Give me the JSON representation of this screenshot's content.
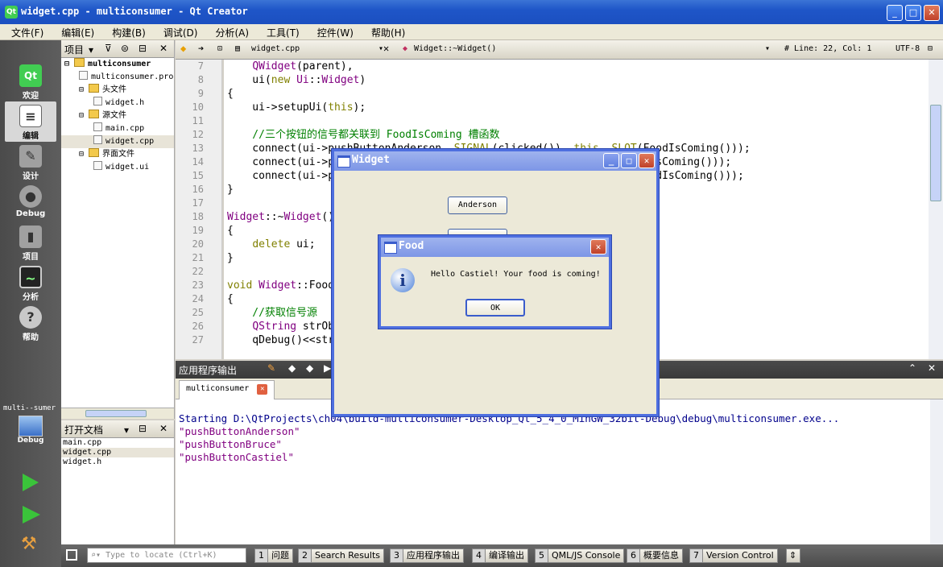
{
  "window": {
    "title": "widget.cpp - multiconsumer - Qt Creator",
    "icon_text": "Qt"
  },
  "menu": [
    "文件(F)",
    "编辑(E)",
    "构建(B)",
    "调试(D)",
    "分析(A)",
    "工具(T)",
    "控件(W)",
    "帮助(H)"
  ],
  "modes": [
    {
      "label": "欢迎",
      "icon": "qt-logo-icon"
    },
    {
      "label": "编辑",
      "icon": "edit-document-icon"
    },
    {
      "label": "设计",
      "icon": "design-pen-icon"
    },
    {
      "label": "Debug",
      "icon": "debug-bug-icon"
    },
    {
      "label": "项目",
      "icon": "project-icon"
    },
    {
      "label": "分析",
      "icon": "analyze-monitor-icon"
    },
    {
      "label": "帮助",
      "icon": "help-icon"
    }
  ],
  "kit": {
    "project": "multi--sumer",
    "mode": "Debug"
  },
  "project_panel": {
    "title": "项目",
    "tree": [
      {
        "label": "multiconsumer",
        "level": 0,
        "type": "root"
      },
      {
        "label": "multiconsumer.pro",
        "level": 1,
        "type": "file"
      },
      {
        "label": "头文件",
        "level": 1,
        "type": "folder"
      },
      {
        "label": "widget.h",
        "level": 2,
        "type": "file"
      },
      {
        "label": "源文件",
        "level": 1,
        "type": "folder"
      },
      {
        "label": "main.cpp",
        "level": 2,
        "type": "file"
      },
      {
        "label": "widget.cpp",
        "level": 2,
        "type": "file",
        "selected": true
      },
      {
        "label": "界面文件",
        "level": 1,
        "type": "folder"
      },
      {
        "label": "widget.ui",
        "level": 2,
        "type": "file"
      }
    ]
  },
  "open_docs": {
    "title": "打开文档",
    "items": [
      "main.cpp",
      "widget.cpp",
      "widget.h"
    ]
  },
  "editor_toolbar": {
    "file": "widget.cpp",
    "symbol": "Widget::~Widget()",
    "position": "#  Line: 22, Col: 1",
    "encoding": "UTF-8"
  },
  "code_lines": [
    {
      "n": "7",
      "text": "    QWidget(parent),"
    },
    {
      "n": "8",
      "text": "    ui(new Ui::Widget)"
    },
    {
      "n": "9",
      "text": "{"
    },
    {
      "n": "10",
      "text": "    ui->setupUi(this);"
    },
    {
      "n": "11",
      "text": ""
    },
    {
      "n": "12",
      "text": "    //三个按钮的信号都关联到 FoodIsComing 槽函数"
    },
    {
      "n": "13",
      "text": "    connect(ui->pushButtonAnderson, SIGNAL(clicked()), this, SLOT(FoodIsComing()));"
    },
    {
      "n": "14",
      "text": "    connect(ui->pushButtonBruce, SIGNAL(clicked()), this, SLOT(FoodIsComing()));"
    },
    {
      "n": "15",
      "text": "    connect(ui->pushButtonCastiel, SIGNAL(clicked()), this, SLOT(FoodIsComing()));"
    },
    {
      "n": "16",
      "text": "}"
    },
    {
      "n": "17",
      "text": ""
    },
    {
      "n": "18",
      "text": "Widget::~Widget()"
    },
    {
      "n": "19",
      "text": "{"
    },
    {
      "n": "20",
      "text": "    delete ui;"
    },
    {
      "n": "21",
      "text": "}"
    },
    {
      "n": "22",
      "text": ""
    },
    {
      "n": "23",
      "text": "void Widget::FoodIsComing()"
    },
    {
      "n": "24",
      "text": "{"
    },
    {
      "n": "25",
      "text": "    //获取信号源"
    },
    {
      "n": "26",
      "text": "    QString strObjectSrc = this->sender()->objectName();"
    },
    {
      "n": "27",
      "text": "    qDebug()<<strObjectSrc;"
    }
  ],
  "output_pane": {
    "title": "应用程序输出",
    "tab": "multiconsumer",
    "start_line": "Starting D:\\QtProjects\\ch04\\build-multiconsumer-Desktop_Qt_5_4_0_MinGW_32bit-Debug\\debug\\multiconsumer.exe...",
    "lines": [
      "\"pushButtonAnderson\"",
      "\"pushButtonBruce\"",
      "\"pushButtonCastiel\""
    ]
  },
  "status": {
    "locate_placeholder": "Type to locate (Ctrl+K)",
    "tabs": [
      {
        "n": "1",
        "label": "问题"
      },
      {
        "n": "2",
        "label": "Search Results"
      },
      {
        "n": "3",
        "label": "应用程序输出"
      },
      {
        "n": "4",
        "label": "编译输出"
      },
      {
        "n": "5",
        "label": "QML/JS Console"
      },
      {
        "n": "6",
        "label": "概要信息"
      },
      {
        "n": "7",
        "label": "Version Control"
      }
    ]
  },
  "widget_dialog": {
    "title": "Widget",
    "button1": "Anderson"
  },
  "food_dialog": {
    "title": "Food",
    "message": "Hello Castiel! Your food is coming!",
    "ok": "OK"
  },
  "colors": {
    "titlebar": "#1f56c8",
    "keyword": "#808000",
    "comment": "#008000",
    "output_blue": "#00008b",
    "output_purple": "#800080"
  }
}
